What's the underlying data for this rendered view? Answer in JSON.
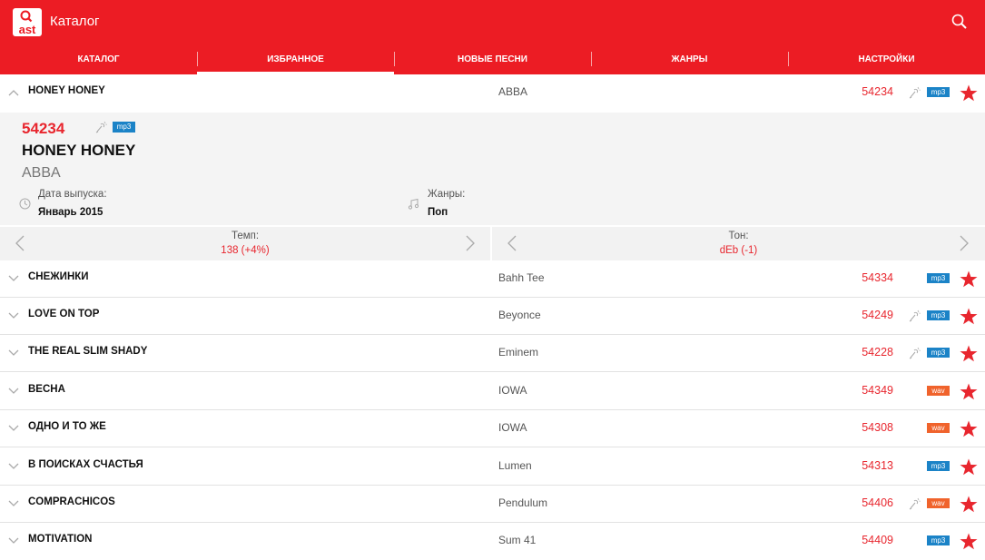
{
  "appbar": {
    "logo_text": "ast",
    "title": "Каталог"
  },
  "tabs": [
    {
      "label": "Каталог",
      "active": false
    },
    {
      "label": "Избранное",
      "active": true
    },
    {
      "label": "Новые песни",
      "active": false
    },
    {
      "label": "Жанры",
      "active": false
    },
    {
      "label": "Настройки",
      "active": false
    }
  ],
  "expanded": {
    "song": "HONEY HONEY",
    "artist": "ABBA",
    "number": "54234",
    "format": "mp3",
    "release_label": "Дата выпуска:",
    "release_value": "Январь 2015",
    "genre_label": "Жанры:",
    "genre_value": "Поп",
    "tempo_label": "Темп:",
    "tempo_value": "138 (+4%)",
    "key_label": "Тон:",
    "key_value": "dEb (-1)"
  },
  "songs": [
    {
      "title": "HONEY HONEY",
      "artist": "ABBA",
      "number": "54234",
      "mic": true,
      "format": "mp3"
    },
    {
      "title": "СНЕЖИНКИ",
      "artist": "Bahh Tee",
      "number": "54334",
      "mic": false,
      "format": "mp3"
    },
    {
      "title": "LOVE ON TOP",
      "artist": "Beyonce",
      "number": "54249",
      "mic": true,
      "format": "mp3"
    },
    {
      "title": "THE REAL SLIM SHADY",
      "artist": "Eminem",
      "number": "54228",
      "mic": true,
      "format": "mp3"
    },
    {
      "title": "ВЕСНА",
      "artist": "IOWA",
      "number": "54349",
      "mic": false,
      "format": "wav"
    },
    {
      "title": "ОДНО И ТО ЖЕ",
      "artist": "IOWA",
      "number": "54308",
      "mic": false,
      "format": "wav"
    },
    {
      "title": "В ПОИСКАХ СЧАСТЬЯ",
      "artist": "Lumen",
      "number": "54313",
      "mic": false,
      "format": "mp3"
    },
    {
      "title": "COMPRACHICOS",
      "artist": "Pendulum",
      "number": "54406",
      "mic": true,
      "format": "wav"
    },
    {
      "title": "MOTIVATION",
      "artist": "Sum 41",
      "number": "54409",
      "mic": false,
      "format": "mp3"
    }
  ],
  "colors": {
    "brand": "#ec1c24",
    "mp3": "#1b83c7",
    "wav": "#f0632c"
  }
}
